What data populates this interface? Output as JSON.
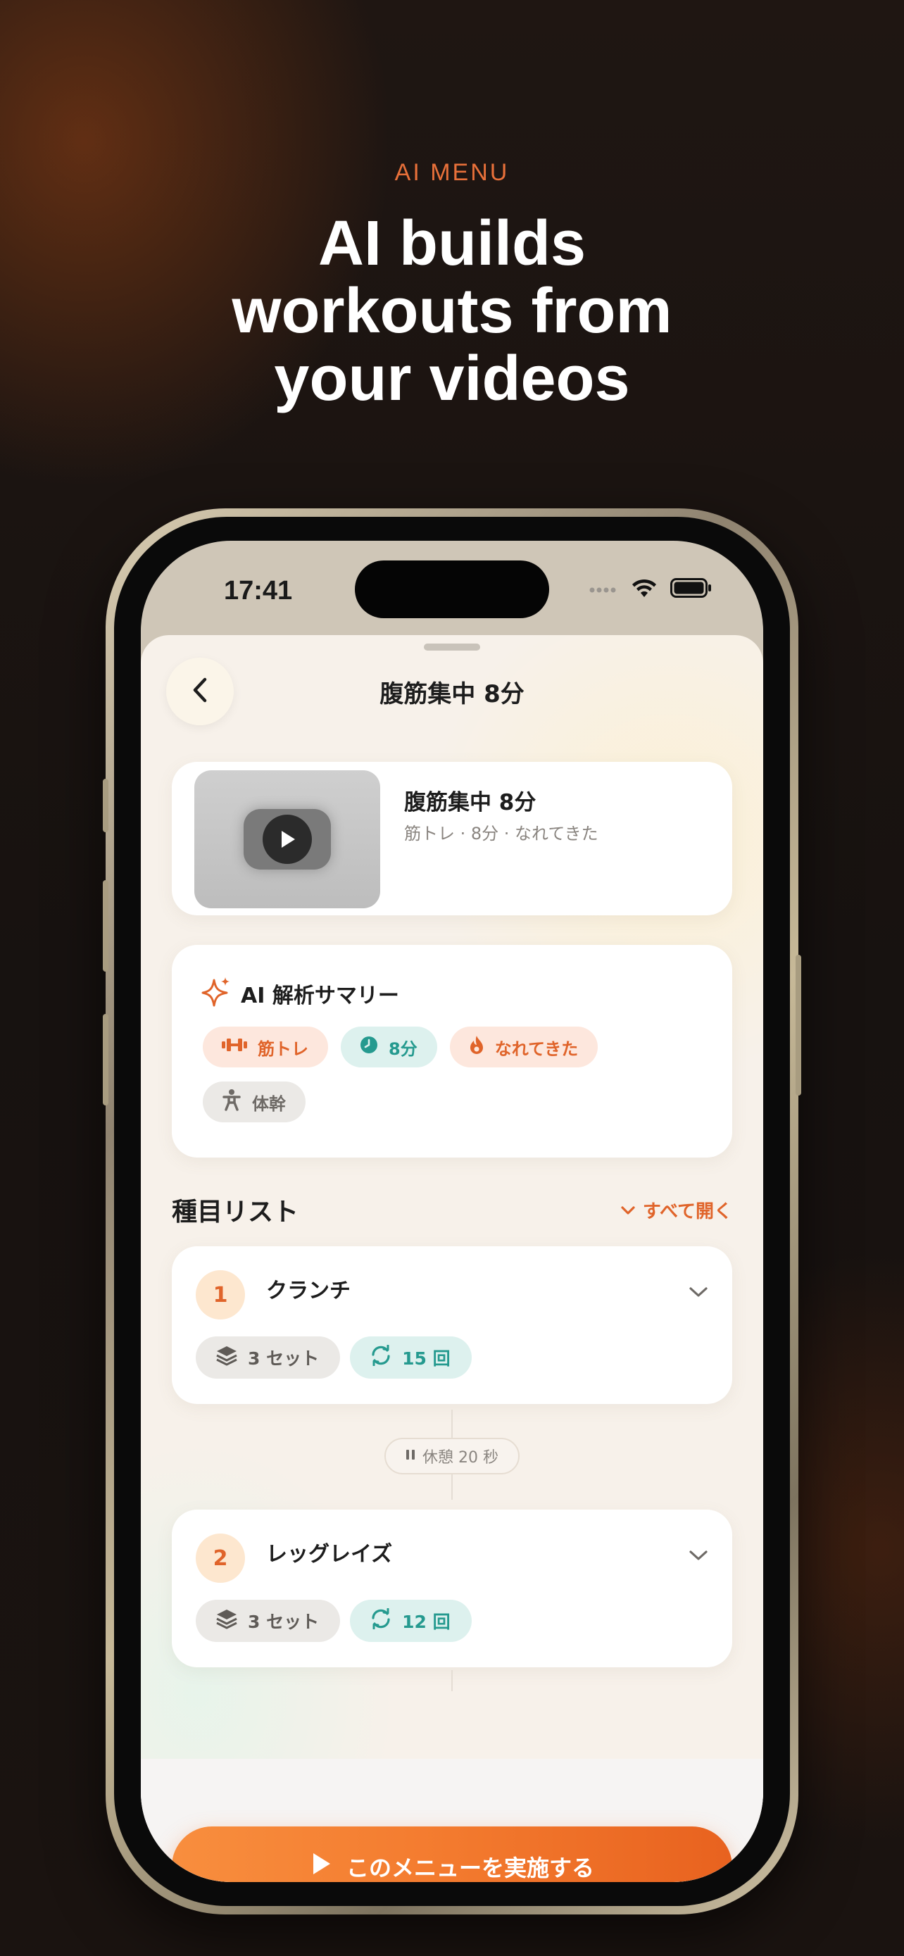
{
  "marketing": {
    "eyebrow": "AI MENU",
    "headline": "AI builds\nworkouts from\nyour videos"
  },
  "status_bar": {
    "time": "17:41"
  },
  "sheet": {
    "title": "腹筋集中 8分"
  },
  "video": {
    "title": "腹筋集中 8分",
    "meta": "筋トレ · 8分 · なれてきた"
  },
  "summary": {
    "title": "AI 解析サマリー",
    "tags": [
      {
        "label": "筋トレ",
        "icon": "dumbbell-icon",
        "tone": "orange"
      },
      {
        "label": "8分",
        "icon": "clock-icon",
        "tone": "teal"
      },
      {
        "label": "なれてきた",
        "icon": "flame-icon",
        "tone": "orange"
      },
      {
        "label": "体幹",
        "icon": "body-icon",
        "tone": "gray"
      }
    ]
  },
  "exercises_section": {
    "title": "種目リスト",
    "expand_all": "すべて開く"
  },
  "exercises": [
    {
      "number": "1",
      "name": "クランチ",
      "sets": "3 セット",
      "reps": "15 回"
    },
    {
      "number": "2",
      "name": "レッグレイズ",
      "sets": "3 セット",
      "reps": "12 回"
    }
  ],
  "rest": {
    "label": "休憩 20 秒"
  },
  "cta": {
    "label": "このメニューを実施する"
  },
  "colors": {
    "accent": "#e0642a",
    "teal": "#259a8f",
    "cta_start": "#f88e3e",
    "cta_end": "#e8621f"
  }
}
